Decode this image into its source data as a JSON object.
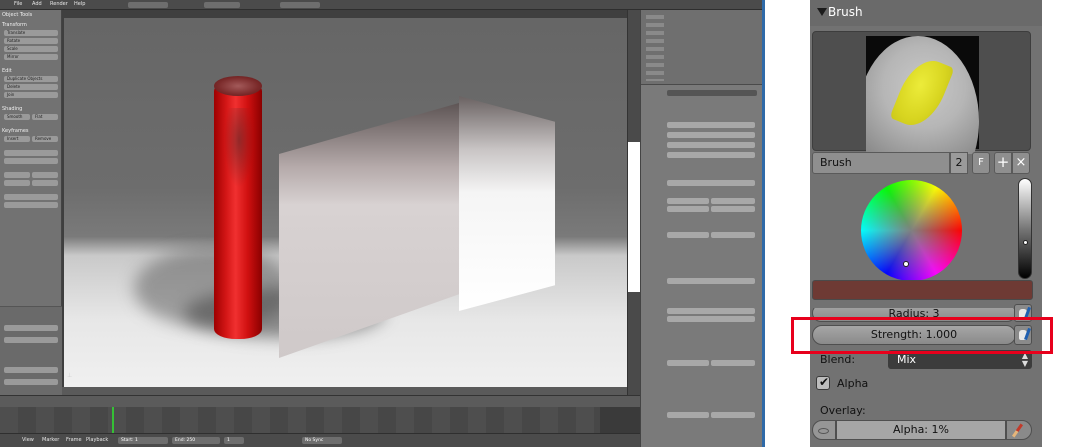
{
  "blender": {
    "top_menu": [
      "File",
      "Add",
      "Render",
      "Help"
    ],
    "toolshelf": {
      "header": "Object Tools",
      "sections": [
        {
          "title": "Transform",
          "buttons": [
            "Translate",
            "Rotate",
            "Scale",
            "Mirror"
          ]
        },
        {
          "title": "Edit",
          "buttons": [
            "Duplicate Objects",
            "Delete",
            "Join"
          ]
        },
        {
          "title": "Shading",
          "buttons": [
            "Smooth",
            "Flat"
          ]
        },
        {
          "title": "Keyframes",
          "buttons": [
            "Insert",
            "Remove"
          ]
        }
      ]
    },
    "timeline": {
      "start_label": "Start: 1",
      "end_label": "End: 250",
      "frame_label": "1"
    },
    "footer": {
      "items": [
        "View",
        "Marker",
        "Frame",
        "Playback"
      ],
      "sync": "No Sync"
    }
  },
  "brush_panel": {
    "title": "Brush",
    "brush_name": "Brush",
    "users": "2",
    "fake_user": "F",
    "add_label": "+",
    "remove_label": "×",
    "radius_label": "Radius: 3",
    "strength_label": "Strength: 1.000",
    "blend_label": "Blend:",
    "blend_value": "Mix",
    "alpha_label": "Alpha",
    "alpha_checked": true,
    "overlay_label": "Overlay:",
    "overlay_alpha_label": "Alpha: 1%",
    "color_hex": "#6e3a34",
    "highlight_color": "#e8001c"
  }
}
